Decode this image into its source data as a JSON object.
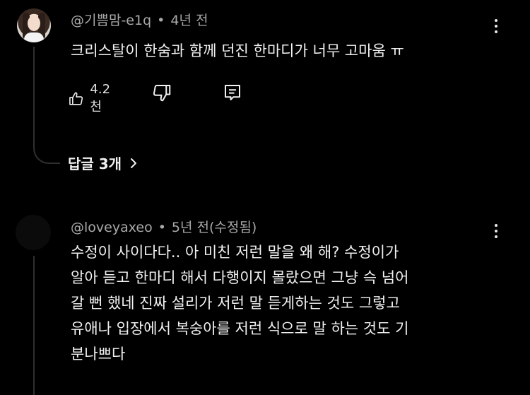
{
  "comment1": {
    "author": "@기쁨맘-e1q",
    "separator": "•",
    "time": "4년 전",
    "text": "크리스탈이 한숨과 함께 던진 한마디가 너무 고마움 ㅠ",
    "likes": "4.2천",
    "replies_label": "답글 3개"
  },
  "comment2": {
    "author": "@loveyaxeo",
    "separator": "•",
    "time": "5년 전(수정됨)",
    "lines": [
      "수정이 사이다다.. 아 미친 저런 말을 왜 해? 수정이가",
      "알아 듣고 한마디 해서 다행이지 몰랐으면 그냥 슥 넘어",
      "갈 뻔 했네 진짜 설리가 저런 말 듣게하는 것도 그렇고",
      "유애나 입장에서 복숭아를 저런 식으로 말 하는 것도 기",
      "분나쁘다"
    ]
  },
  "icons": {
    "like": "thumbs-up-icon",
    "dislike": "thumbs-down-icon",
    "reply": "comment-reply-icon",
    "more": "more-vertical-icon",
    "chevron": "chevron-right-icon"
  }
}
